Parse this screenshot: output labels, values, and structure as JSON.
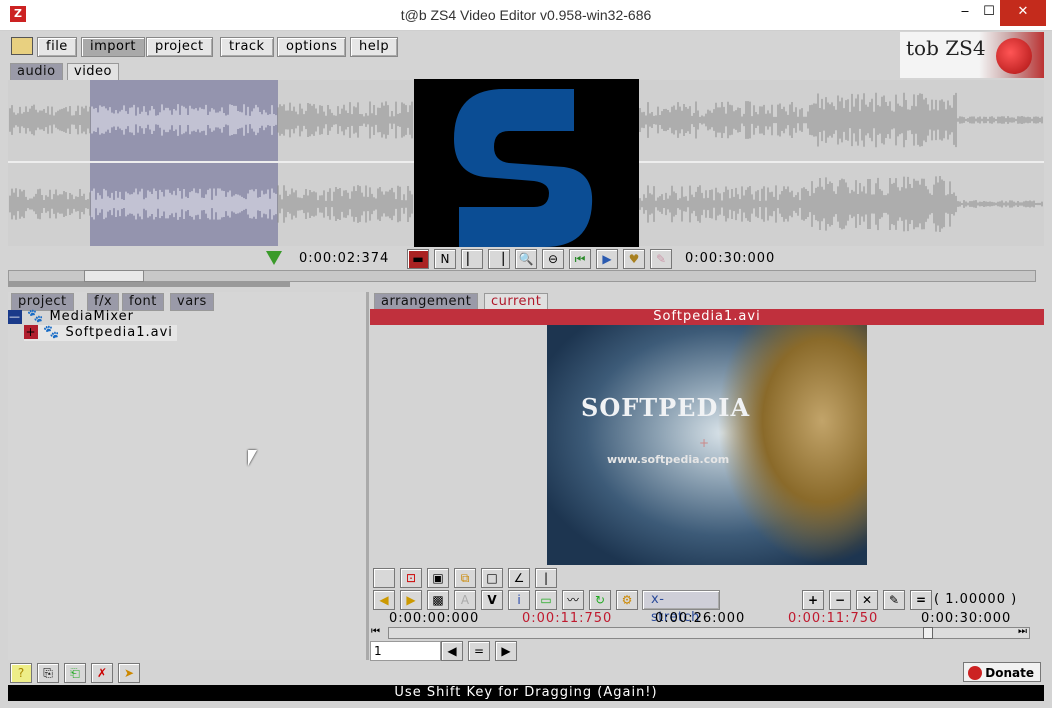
{
  "window": {
    "title": "t@b ZS4 Video Editor v0.958-win32-686",
    "app_icon": "Z",
    "minimize": "‒",
    "maximize": "☐",
    "close": "✕"
  },
  "menu": [
    "file",
    "import",
    "project",
    "track",
    "options",
    "help"
  ],
  "mode_tabs": [
    "audio",
    "video"
  ],
  "logo": {
    "text": "tob ZS4"
  },
  "transport": {
    "current_time": "0:00:02:374",
    "end_time": "0:00:30:000",
    "icons": [
      "record-icon",
      "no-sync-icon",
      "mark-in-icon",
      "mark-out-icon",
      "zoom-in-icon",
      "zoom-out-icon",
      "rewind-icon",
      "play-icon",
      "heart-icon",
      "bookmark-icon"
    ]
  },
  "left_tabs": [
    "project",
    "f/x",
    "font",
    "vars"
  ],
  "tree": [
    {
      "toggle": "—",
      "label": "MediaMixer"
    },
    {
      "toggle": "+",
      "label": "Softpedia1.avi"
    }
  ],
  "right_tabs": [
    "arrangement",
    "current"
  ],
  "preview": {
    "filename": "Softpedia1.avi",
    "logo_text": "SOFTPEDIA",
    "url_text": "www.softpedia.com"
  },
  "edit_tools": {
    "x_stretch_label": "x-stretch",
    "scale_value": "( 1.00000 )"
  },
  "timeline": {
    "times": [
      "0:00:00:000",
      "0:00:11:750",
      "0:00:26:000",
      "0:00:11:750",
      "0:00:30:000"
    ],
    "frame_value": "1"
  },
  "donate": {
    "label": "Donate"
  },
  "status": {
    "message": "Use Shift Key for Dragging (Again!)"
  }
}
